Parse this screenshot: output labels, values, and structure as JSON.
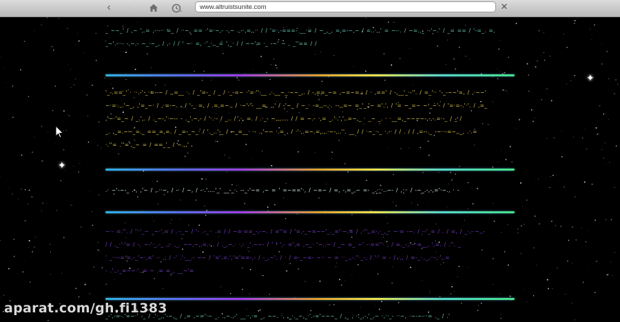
{
  "browser": {
    "url": "www.altruistsunite.com",
    "back_icon": "chevron-left-icon",
    "forward_icon": "chevron-right-icon",
    "home_icon": "home-icon",
    "history_icon": "history-icon",
    "close_icon": "close-icon"
  },
  "page": {
    "paragraphs": [
      "",
      "",
      "",
      "",
      ""
    ],
    "colors": {
      "background": "#000000",
      "paragraph_1": "#6fd4bf",
      "paragraph_2": "#e6cf4e",
      "paragraph_3": "#d8f0e9",
      "paragraph_4": "#7f42d8",
      "paragraph_5": "#74d3a8",
      "rule_gradient": [
        "#2fb2e6",
        "#a43be6",
        "#f0e34a",
        "#43e38a"
      ]
    }
  },
  "watermark": {
    "text": "aparat.com/gh.fi1383"
  }
}
